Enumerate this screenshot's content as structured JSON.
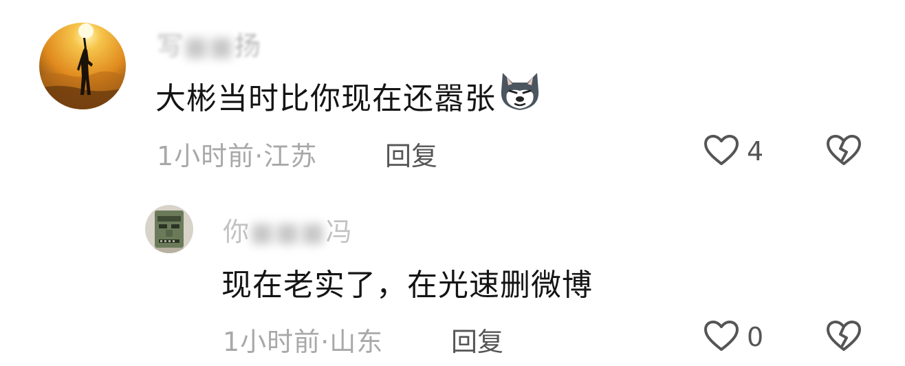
{
  "comments": [
    {
      "username_visible_start": "写",
      "username_visible_end": "扬",
      "content": "大彬当时比你现在还嚣张",
      "emoji_icon": "husky-face-icon",
      "time": "1小时前",
      "location": "江苏",
      "separator": "·",
      "reply_label": "回复",
      "like_count": "4"
    },
    {
      "username_visible_start": "你",
      "username_visible_end": "冯",
      "content": "现在老实了，在光速删微博",
      "time": "1小时前",
      "location": "山东",
      "separator": "·",
      "reply_label": "回复",
      "like_count": "0"
    }
  ],
  "colors": {
    "meta": "#a8a8a8",
    "icon": "#555555"
  }
}
